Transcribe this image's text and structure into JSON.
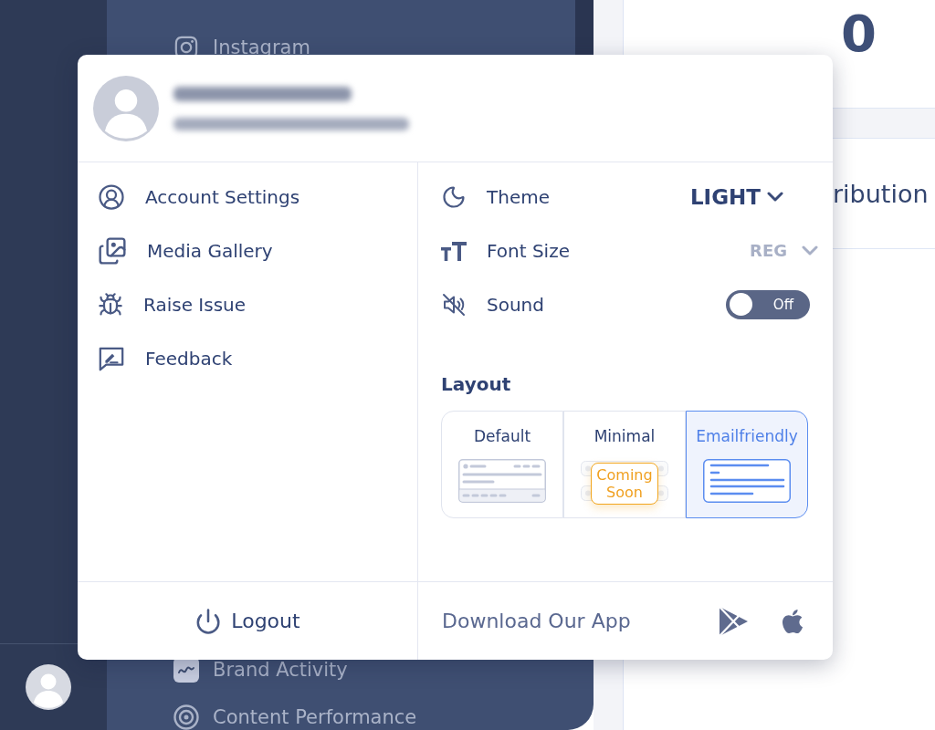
{
  "sidebar": {
    "items": [
      {
        "label": "Instagram"
      },
      {
        "label": "Brand Activity"
      },
      {
        "label": "Content Performance"
      }
    ]
  },
  "content": {
    "stat_value": "0",
    "section_title": "ribution"
  },
  "popup": {
    "menu": [
      {
        "label": "Account Settings"
      },
      {
        "label": "Media Gallery"
      },
      {
        "label": "Raise Issue"
      },
      {
        "label": "Feedback"
      }
    ],
    "settings": [
      {
        "kind": "select",
        "label": "Theme",
        "value": "LIGHT",
        "disabled": false
      },
      {
        "kind": "select",
        "label": "Font Size",
        "value": "REG",
        "disabled": true
      },
      {
        "kind": "toggle",
        "label": "Sound",
        "on": false,
        "state_text": "Off"
      }
    ],
    "layout": {
      "title": "Layout",
      "options": [
        {
          "label": "Default",
          "selected": false
        },
        {
          "label": "Minimal",
          "selected": false,
          "badge": "Coming Soon"
        },
        {
          "label": "Emailfriendly",
          "selected": true
        }
      ]
    },
    "logout": {
      "label": "Logout"
    },
    "download": {
      "label": "Download Our App"
    }
  }
}
